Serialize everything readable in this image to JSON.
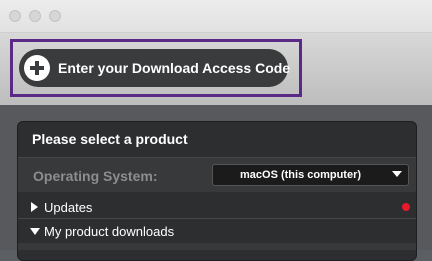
{
  "window": {
    "traffic_lights": [
      "close-dot",
      "minimize-dot",
      "zoom-dot"
    ]
  },
  "banner": {
    "access_code_button": {
      "label": "Enter your Download Access Code",
      "icon": "plus-circle-icon"
    },
    "highlight_color": "#5b2a86"
  },
  "product_panel": {
    "title": "Please select a product",
    "os_label": "Operating System:",
    "os_select": {
      "value": "macOS (this computer)",
      "icon": "chevron-down-icon"
    },
    "items": [
      {
        "label": "Updates",
        "icon": "triangle-right-icon",
        "has_alert": true
      },
      {
        "label": "My product downloads",
        "icon": "triangle-down-icon",
        "has_alert": false
      }
    ],
    "alert_color": "#e8192c"
  }
}
